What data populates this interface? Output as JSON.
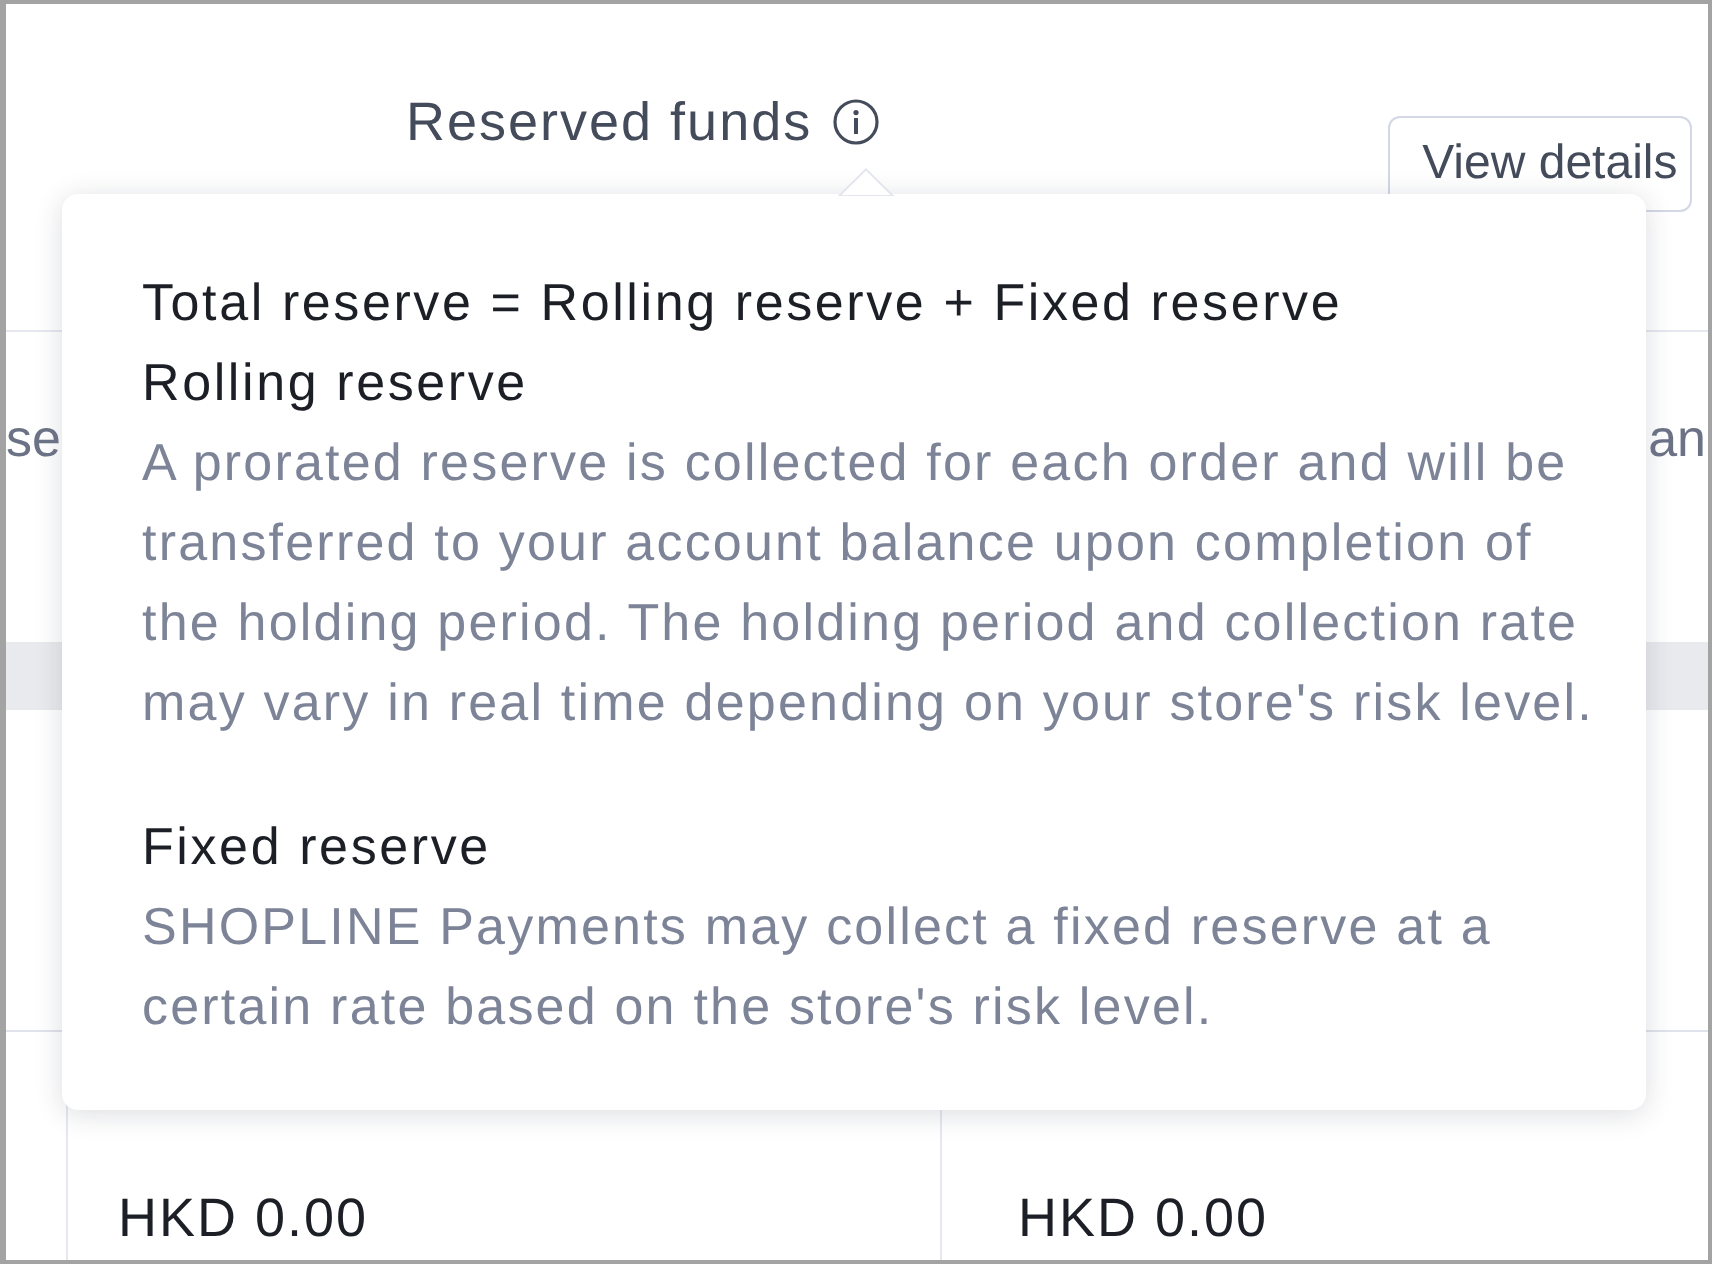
{
  "header": {
    "title": "Reserved funds",
    "button": "View details"
  },
  "column_labels": [
    "se",
    "an"
  ],
  "balances": [
    "HKD 0.00",
    "HKD 0.00"
  ],
  "popover": {
    "formula": "Total reserve = Rolling reserve + Fixed reserve",
    "sections": [
      {
        "heading": "Rolling reserve",
        "body": "A prorated reserve is collected for each order and will be transferred to your account balance upon completion of the holding period. The holding period and collection rate may vary in real time depending on your store's risk level."
      },
      {
        "heading": "Fixed reserve",
        "body": "SHOPLINE Payments may collect a fixed reserve at a certain rate based on the store's risk level."
      }
    ]
  }
}
